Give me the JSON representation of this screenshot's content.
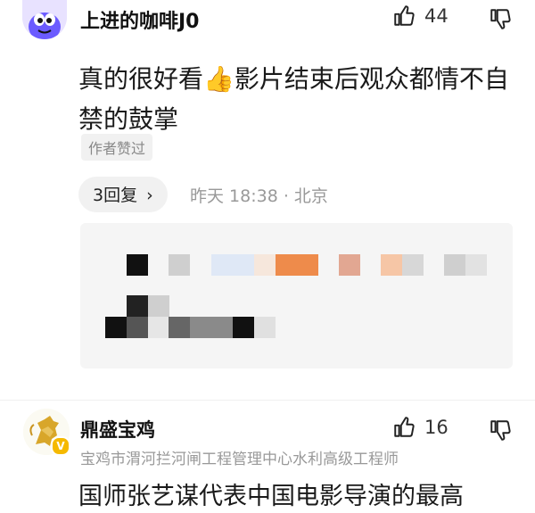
{
  "comments": [
    {
      "username": "上进的咖啡J0",
      "avatar_icon": "cartoon-dino-avatar-icon",
      "likes": "44",
      "text": "真的很好看👍影片结束后观众都情不自禁的鼓掌",
      "author_liked": "作者赞过",
      "reply_label": "3回复",
      "reply_chevron": "›",
      "time_location": "昨天 18:38 · 北京"
    },
    {
      "username": "鼎盛宝鸡",
      "avatar_icon": "golden-horse-avatar-icon",
      "verified": "V",
      "user_title": "宝鸡市渭河拦河闸工程管理中心水利高级工程师",
      "likes": "16",
      "text": "国师张艺谋代表中国电影导演的最高"
    }
  ],
  "colors": {
    "background": "#ffffff",
    "meta_gray": "#999999",
    "pill_bg": "#f1f1f1",
    "verified_badge": "#f5b900"
  }
}
